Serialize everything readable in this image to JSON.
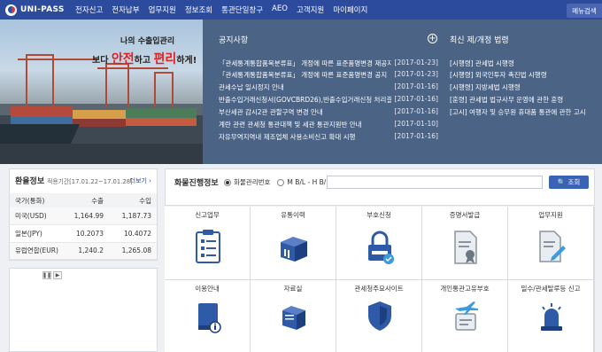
{
  "header": {
    "logo_text": "UNI-PASS",
    "nav": [
      "전자신고",
      "전자납부",
      "업무지원",
      "정보조회",
      "통관단일창구",
      "AEO",
      "고객지원",
      "마이페이지"
    ],
    "menu_search": "메뉴검색"
  },
  "hero": {
    "line1": "나의 수출입관리",
    "pre": "보다 ",
    "em1": "안전",
    "mid": "하고 ",
    "em2": "편리",
    "post": "하게!"
  },
  "notice": {
    "title": "공지사항",
    "items": [
      {
        "text": "「관세통계통합품목분류표」 개정에 따른 표준품명변경 재공지",
        "date": "[2017-01-23]"
      },
      {
        "text": "「관세통계통합품목분류표」 개정에 따른 표준품명변경 공지",
        "date": "[2017-01-23]"
      },
      {
        "text": "관세수납 일시정지 안내",
        "date": "[2017-01-16]"
      },
      {
        "text": "반출수입거래신청서(GOVCBRD26),반출수입거래신청 처리결...",
        "date": "[2017-01-16]"
      },
      {
        "text": "부산세관 감시2관 관할구역 변경 안내",
        "date": "[2017-01-16]"
      },
      {
        "text": "계란 관련 관세청 통관대책 및 세관 통관지원반 안내",
        "date": "[2017-01-10]"
      },
      {
        "text": "자유무역지역내 제조업체 사용소비신고 확대 시행",
        "date": "[2017-01-16]"
      }
    ]
  },
  "law": {
    "title": "최신 제/개정 법령",
    "items": [
      "[시행령] 관세법 시행령",
      "[시행령] 외국인투자 촉진법 시행령",
      "[시행령] 지방세법 시행령",
      "[훈령] 관세법 법규사무 운영에 관한 훈령",
      "[고시] 여행자 및 승무원 휴대품 통관에 관한 고시"
    ]
  },
  "exchange": {
    "title": "환율정보",
    "period": "적용기간[17.01.22~17.01.28]",
    "more": "더보기 ›",
    "headers": [
      "국가(통화)",
      "수출",
      "수입"
    ],
    "rows": [
      [
        "미국(USD)",
        "1,164.99",
        "1,187.73"
      ],
      [
        "일본(JPY)",
        "10.2073",
        "10.4072"
      ],
      [
        "유럽연합(EUR)",
        "1,240.2",
        "1,265.08"
      ]
    ]
  },
  "banner": {
    "prev": "❚❚",
    "next": "▶"
  },
  "tracking": {
    "title": "화물진행정보",
    "opt1": "화물관리번호",
    "opt2": "M B/L - H B/L",
    "input_value": "",
    "button": "🔍 조회"
  },
  "services": [
    {
      "label": "신고업무",
      "icon": "report-icon"
    },
    {
      "label": "유통이력",
      "icon": "boxes-icon"
    },
    {
      "label": "부호신청",
      "icon": "lock-icon"
    },
    {
      "label": "증명서발급",
      "icon": "certificate-icon"
    },
    {
      "label": "업무지원",
      "icon": "document-pen-icon"
    },
    {
      "label": "이용안내",
      "icon": "guide-book-icon"
    },
    {
      "label": "자료실",
      "icon": "books-icon"
    },
    {
      "label": "관세청주요사이트",
      "icon": "shield-icon"
    },
    {
      "label": "개인통관고유부호",
      "icon": "plane-icon"
    },
    {
      "label": "밀수/관세탈루등 신고",
      "icon": "siren-icon"
    }
  ],
  "colors": {
    "brand": "#2c4b9c",
    "panel": "#4b6385",
    "button": "#3a62b5",
    "accent_red": "#d22"
  }
}
